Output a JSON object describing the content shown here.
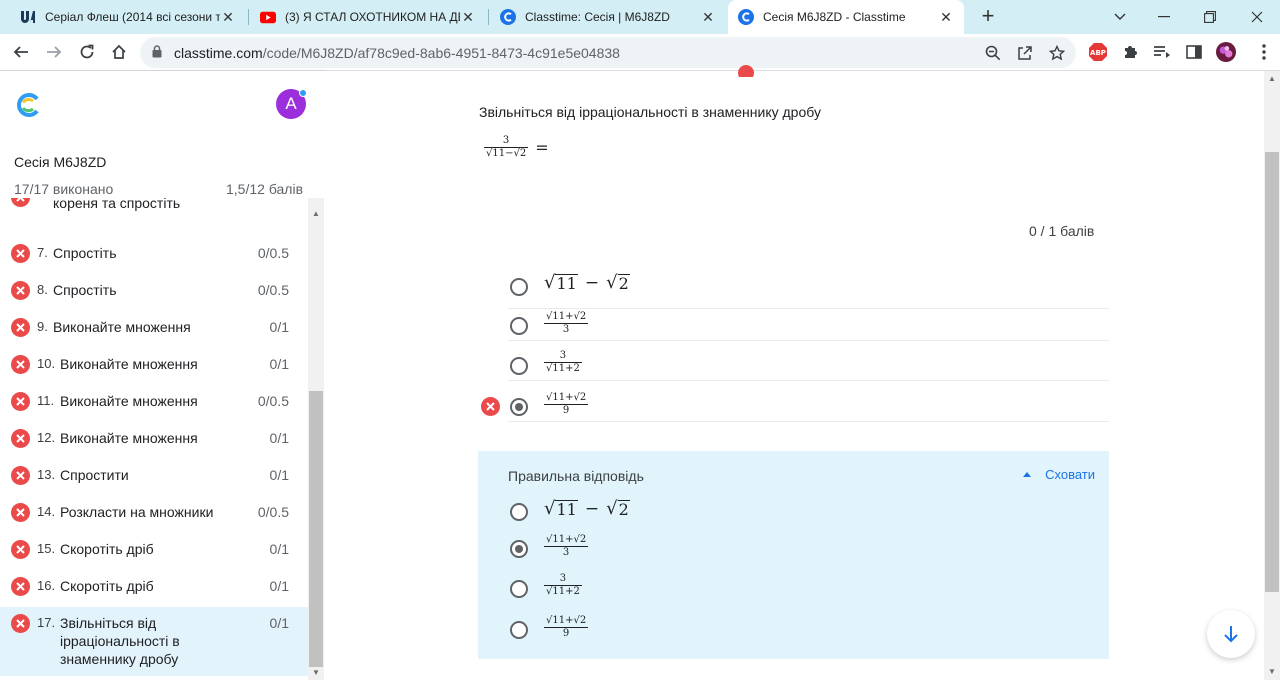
{
  "browser": {
    "tabs": [
      {
        "title": "Серіал Флеш (2014 всі сезони та",
        "icon": "ua-site-icon"
      },
      {
        "title": "(3) Я СТАЛ ОХОТНИКОМ НА ДЕ",
        "icon": "youtube-icon"
      },
      {
        "title": "Classtime: Сесія | M6J8ZD",
        "icon": "classtime-icon"
      },
      {
        "title": "Сесія M6J8ZD - Classtime",
        "icon": "classtime-icon",
        "active": true
      }
    ],
    "url_host": "classtime.com",
    "url_path": "/code/M6J8ZD/af78c9ed-8ab6-4951-8473-4c91e5e04838",
    "adblock_label": "ABP"
  },
  "sidebar": {
    "avatar_letter": "A",
    "session_title": "Сесія M6J8ZD",
    "progress": "17/17 виконано",
    "score": "1,5/12 балів",
    "partial_item": {
      "label": "кореня та спростіть"
    },
    "items": [
      {
        "num": "7.",
        "label": "Спростіть",
        "points": "0/0.5"
      },
      {
        "num": "8.",
        "label": "Спростіть",
        "points": "0/0.5"
      },
      {
        "num": "9.",
        "label": "Виконайте множення",
        "points": "0/1"
      },
      {
        "num": "10.",
        "label": "Виконайте множення",
        "points": "0/1"
      },
      {
        "num": "11.",
        "label": "Виконайте множення",
        "points": "0/0.5"
      },
      {
        "num": "12.",
        "label": "Виконайте множення",
        "points": "0/1"
      },
      {
        "num": "13.",
        "label": "Спростити",
        "points": "0/1"
      },
      {
        "num": "14.",
        "label": "Розкласти на множники",
        "points": "0/0.5"
      },
      {
        "num": "15.",
        "label": "Скоротіть дріб",
        "points": "0/1"
      },
      {
        "num": "16.",
        "label": "Скоротіть дріб",
        "points": "0/1"
      },
      {
        "num": "17.",
        "label": "Звільніться від ірраціональності в знаменнику дробу",
        "label_lines": [
          "Звільніться від",
          "ірраціональності в",
          "знаменнику дробу"
        ],
        "points": "0/1"
      }
    ]
  },
  "question": {
    "text": "Звільніться від ірраціональності в знаменнику дробу",
    "expr_num": "3",
    "expr_den": "√11−√2",
    "eq": "=",
    "points": "0  /  1  балів",
    "options": [
      {
        "kind": "diff",
        "a": "11",
        "b": "2",
        "op": "−"
      },
      {
        "kind": "frac",
        "num": "√11+√2",
        "den": "3"
      },
      {
        "kind": "frac",
        "num": "3",
        "den": "√11+2"
      },
      {
        "kind": "frac",
        "num": "√11+√2",
        "den": "9",
        "selected": true,
        "wrong": true
      }
    ]
  },
  "correct": {
    "title": "Правильна відповідь",
    "hide_label": "Сховати",
    "selected_index": 1
  },
  "colors": {
    "accent": "#1a73e8",
    "error": "#ea4a4a",
    "correct_bg": "#e1f4fb",
    "active_item_bg": "#e3f3fb"
  }
}
